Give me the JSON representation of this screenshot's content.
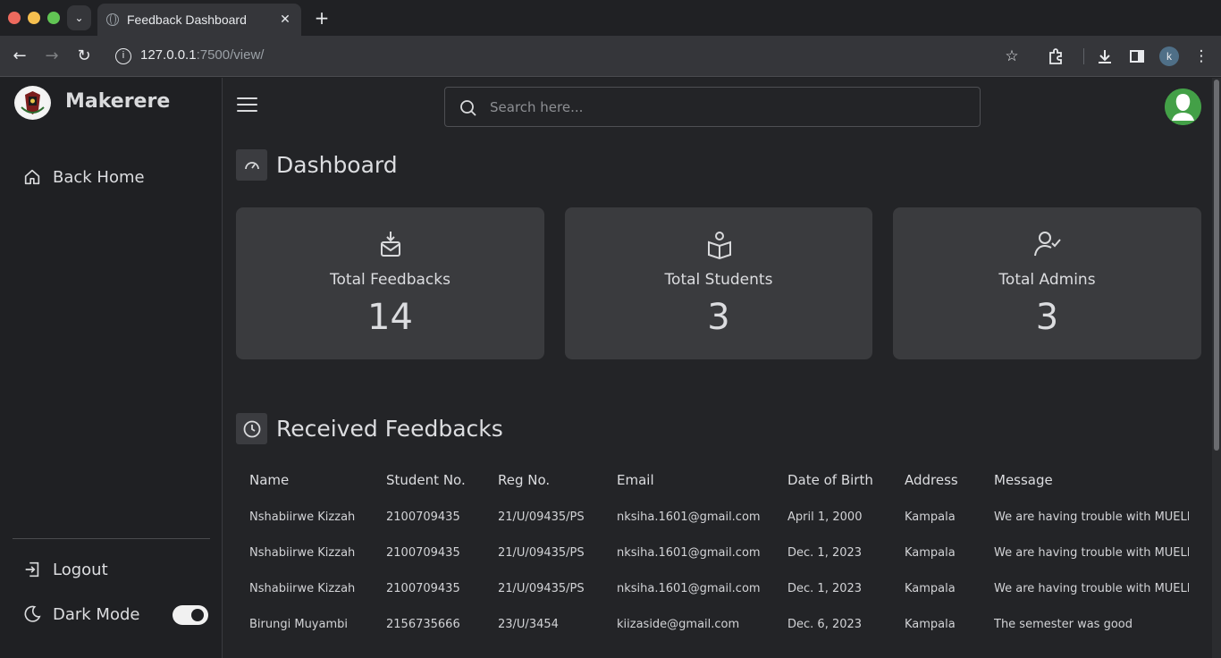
{
  "browser": {
    "tab_title": "Feedback Dashboard",
    "url_host": "127.0.0.1",
    "url_rest": ":7500/view/",
    "profile_initial": "k"
  },
  "sidebar": {
    "brand": "Makerere",
    "items": [
      {
        "label": "Back Home",
        "icon": "home-icon"
      },
      {
        "label": "Logout",
        "icon": "logout-icon"
      },
      {
        "label": "Dark Mode",
        "icon": "moon-icon"
      }
    ],
    "dark_mode_on": true
  },
  "search": {
    "placeholder": "Search here..."
  },
  "dashboard": {
    "title": "Dashboard",
    "cards": [
      {
        "label": "Total Feedbacks",
        "value": "14",
        "icon": "inbox-download-icon"
      },
      {
        "label": "Total Students",
        "value": "3",
        "icon": "book-reader-icon"
      },
      {
        "label": "Total Admins",
        "value": "3",
        "icon": "user-check-icon"
      }
    ]
  },
  "feedbacks": {
    "title": "Received Feedbacks",
    "columns": [
      "Name",
      "Student No.",
      "Reg No.",
      "Email",
      "Date of Birth",
      "Address",
      "Message"
    ],
    "rows": [
      [
        "Nshabiirwe Kizzah",
        "2100709435",
        "21/U/09435/PS",
        "nksiha.1601@gmail.com",
        "April 1, 2000",
        "Kampala",
        "We are having trouble with MUELE"
      ],
      [
        "Nshabiirwe Kizzah",
        "2100709435",
        "21/U/09435/PS",
        "nksiha.1601@gmail.com",
        "Dec. 1, 2023",
        "Kampala",
        "We are having trouble with MUELE"
      ],
      [
        "Nshabiirwe Kizzah",
        "2100709435",
        "21/U/09435/PS",
        "nksiha.1601@gmail.com",
        "Dec. 1, 2023",
        "Kampala",
        "We are having trouble with MUELE"
      ],
      [
        "Birungi Muyambi",
        "2156735666",
        "23/U/3454",
        "kiizaside@gmail.com",
        "Dec. 6, 2023",
        "Kampala",
        "The semester was good"
      ]
    ]
  }
}
